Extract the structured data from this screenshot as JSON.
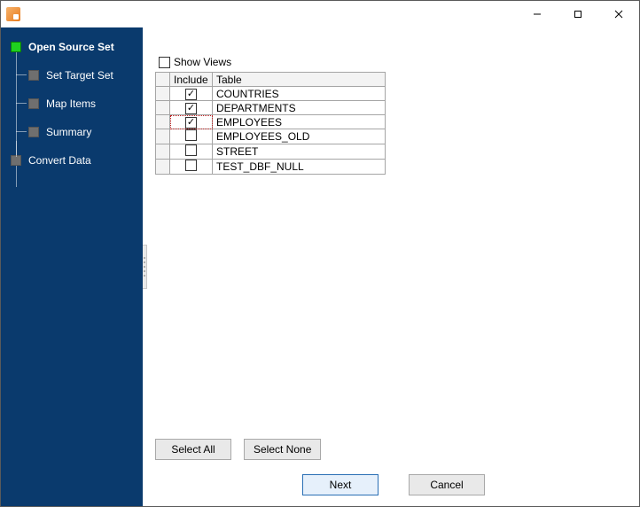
{
  "window": {
    "minimize_tooltip": "Minimize",
    "maximize_tooltip": "Maximize",
    "close_tooltip": "Close"
  },
  "sidebar": {
    "items": [
      {
        "label": "Open Source Set",
        "active": true,
        "level": 0
      },
      {
        "label": "Set Target Set",
        "active": false,
        "level": 1
      },
      {
        "label": "Map Items",
        "active": false,
        "level": 1
      },
      {
        "label": "Summary",
        "active": false,
        "level": 1
      },
      {
        "label": "Convert Data",
        "active": false,
        "level": 0
      }
    ]
  },
  "panel": {
    "show_views_label": "Show Views",
    "show_views_checked": false,
    "columns": {
      "include": "Include",
      "table": "Table"
    },
    "rows": [
      {
        "include": true,
        "table": "COUNTRIES",
        "focused": false
      },
      {
        "include": true,
        "table": "DEPARTMENTS",
        "focused": false
      },
      {
        "include": true,
        "table": "EMPLOYEES",
        "focused": true
      },
      {
        "include": false,
        "table": "EMPLOYEES_OLD",
        "focused": false
      },
      {
        "include": false,
        "table": "STREET",
        "focused": false
      },
      {
        "include": false,
        "table": "TEST_DBF_NULL",
        "focused": false
      }
    ],
    "select_all_label": "Select All",
    "select_none_label": "Select None"
  },
  "footer": {
    "next_label": "Next",
    "cancel_label": "Cancel"
  }
}
